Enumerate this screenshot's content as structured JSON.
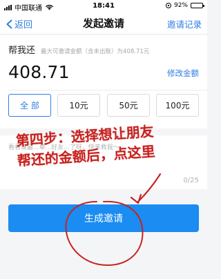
{
  "status_bar": {
    "carrier": "中国联通",
    "time": "18:41",
    "battery": "92%",
    "battery_level": 0.92
  },
  "nav": {
    "back_label": "返回",
    "title": "发起邀请",
    "right_label": "邀请记录"
  },
  "amount_card": {
    "label": "帮我还",
    "hint": "最大可邀请金额（含未出账）为408.71元",
    "amount": "408.71",
    "modify_label": "修改金额",
    "options": [
      {
        "label": "全 部",
        "selected": true
      },
      {
        "label": "10元",
        "selected": false
      },
      {
        "label": "50元",
        "selected": false
      },
      {
        "label": "100元",
        "selected": false
      }
    ]
  },
  "message": {
    "placeholder": "看看谁最...单...好友...了呀，快来救我～",
    "counter": "0/25"
  },
  "generate_button": {
    "label": "生成邀请"
  },
  "annotation": {
    "line1": "第四步：选择想让朋友",
    "line2": "帮还的金额后，点这里",
    "color": "#c8221e"
  },
  "colors": {
    "accent": "#2f7de1",
    "button": "#1a8cf2"
  }
}
